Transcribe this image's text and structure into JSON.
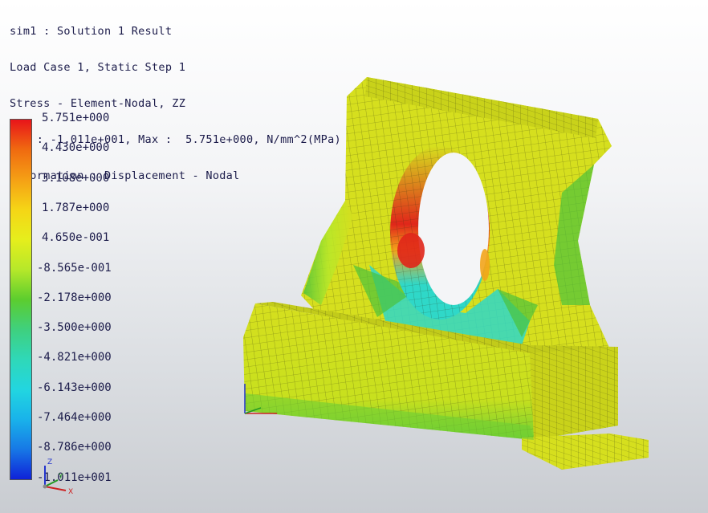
{
  "header": {
    "line1": "sim1 : Solution 1 Result",
    "line2": "Load Case 1, Static Step 1",
    "line3": "Stress - Element-Nodal, ZZ",
    "line4": "Min : -1.011e+001, Max :  5.751e+000, N/mm^2(MPa)",
    "line5": "Deformation : Displacement - Nodal"
  },
  "legend": {
    "labels": [
      "5.751e+000",
      "4.430e+000",
      "3.108e+000",
      "1.787e+000",
      "4.650e-001",
      "-8.565e-001",
      "-2.178e+000",
      "-3.500e+000",
      "-4.821e+000",
      "-6.143e+000",
      "-7.464e+000",
      "-8.786e+000",
      "-1.011e+001"
    ],
    "colors": [
      "#e8141a",
      "#f06a10",
      "#f5a015",
      "#f5d516",
      "#e6ee1c",
      "#b6e82a",
      "#5ccd2e",
      "#3fd07e",
      "#2fd8b8",
      "#22d6e0",
      "#19b3ea",
      "#1778e6",
      "#0f22d8"
    ]
  },
  "triad": {
    "z_label": "Z",
    "y_label": "Y",
    "x_label": "X"
  },
  "model": {
    "colors": {
      "yellow": "#d6df1e",
      "yellow_dark": "#b8c21a",
      "green": "#4cc23a",
      "cyan": "#2fd8c8",
      "orange": "#f3a51b",
      "red": "#e0261a"
    }
  }
}
